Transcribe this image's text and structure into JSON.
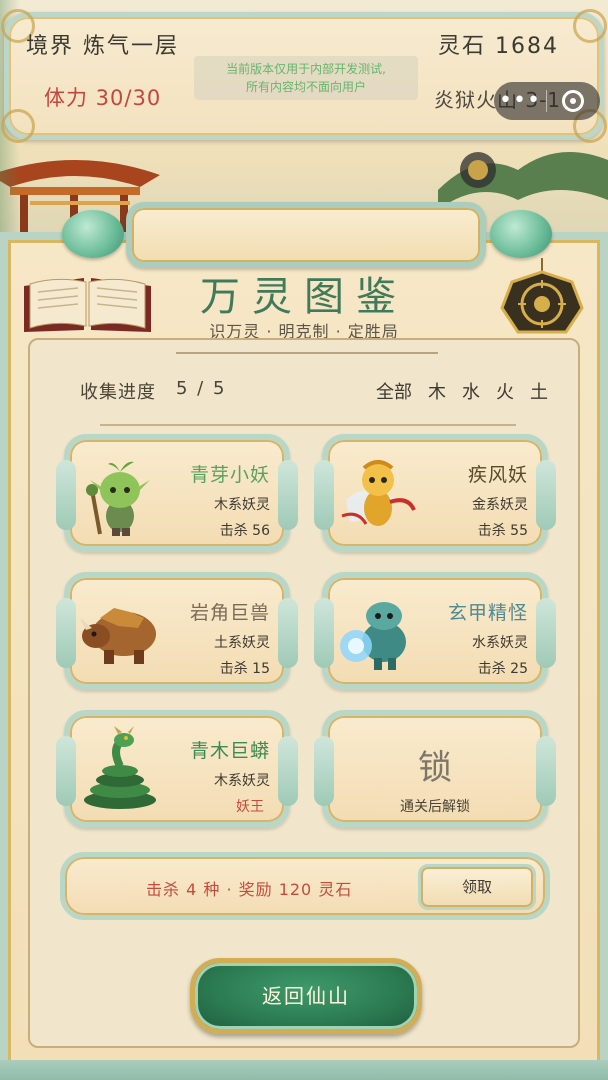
{
  "status": {
    "realm": "境界  炼气一层",
    "spirit_stones": "灵石  1684",
    "stamina": "体力  30/30",
    "location": "炎狱火山 3-1"
  },
  "dev_notice": {
    "line1": "当前版本仅用于内部开发测试,",
    "line2": "所有内容均不面向用户"
  },
  "capsule": {
    "more": "•••"
  },
  "header": {
    "title": "万灵图鉴",
    "subtitle": "识万灵 · 明克制 · 定胜局"
  },
  "collection": {
    "progress_label": "收集进度",
    "progress_value": "5 / 5",
    "progress_fraction": 1.0,
    "filters": [
      "全部",
      "木",
      "水",
      "火",
      "土"
    ]
  },
  "cards": [
    {
      "name": "青芽小妖",
      "type": "木系妖灵",
      "extra": "击杀 56",
      "name_color": "#5aa25c",
      "portrait": "sprout-goblin"
    },
    {
      "name": "疾风妖",
      "type": "金系妖灵",
      "extra": "击杀 55",
      "name_color": "#5a4a2a",
      "portrait": "wind-monkey"
    },
    {
      "name": "岩角巨兽",
      "type": "土系妖灵",
      "extra": "击杀 15",
      "name_color": "#7a6a58",
      "portrait": "rock-rhino"
    },
    {
      "name": "玄甲精怪",
      "type": "水系妖灵",
      "extra": "击杀 25",
      "name_color": "#4f8a92",
      "portrait": "armored-turtle"
    },
    {
      "name": "青木巨蟒",
      "type": "木系妖灵",
      "extra": "妖王",
      "name_color": "#3f8a52",
      "portrait": "green-serpent"
    }
  ],
  "locked_card": {
    "char": "锁",
    "hint": "通关后解锁"
  },
  "reward": {
    "text": "击杀 4 种 · 奖励 120 灵石",
    "claim_label": "领取"
  },
  "return_label": "返回仙山"
}
